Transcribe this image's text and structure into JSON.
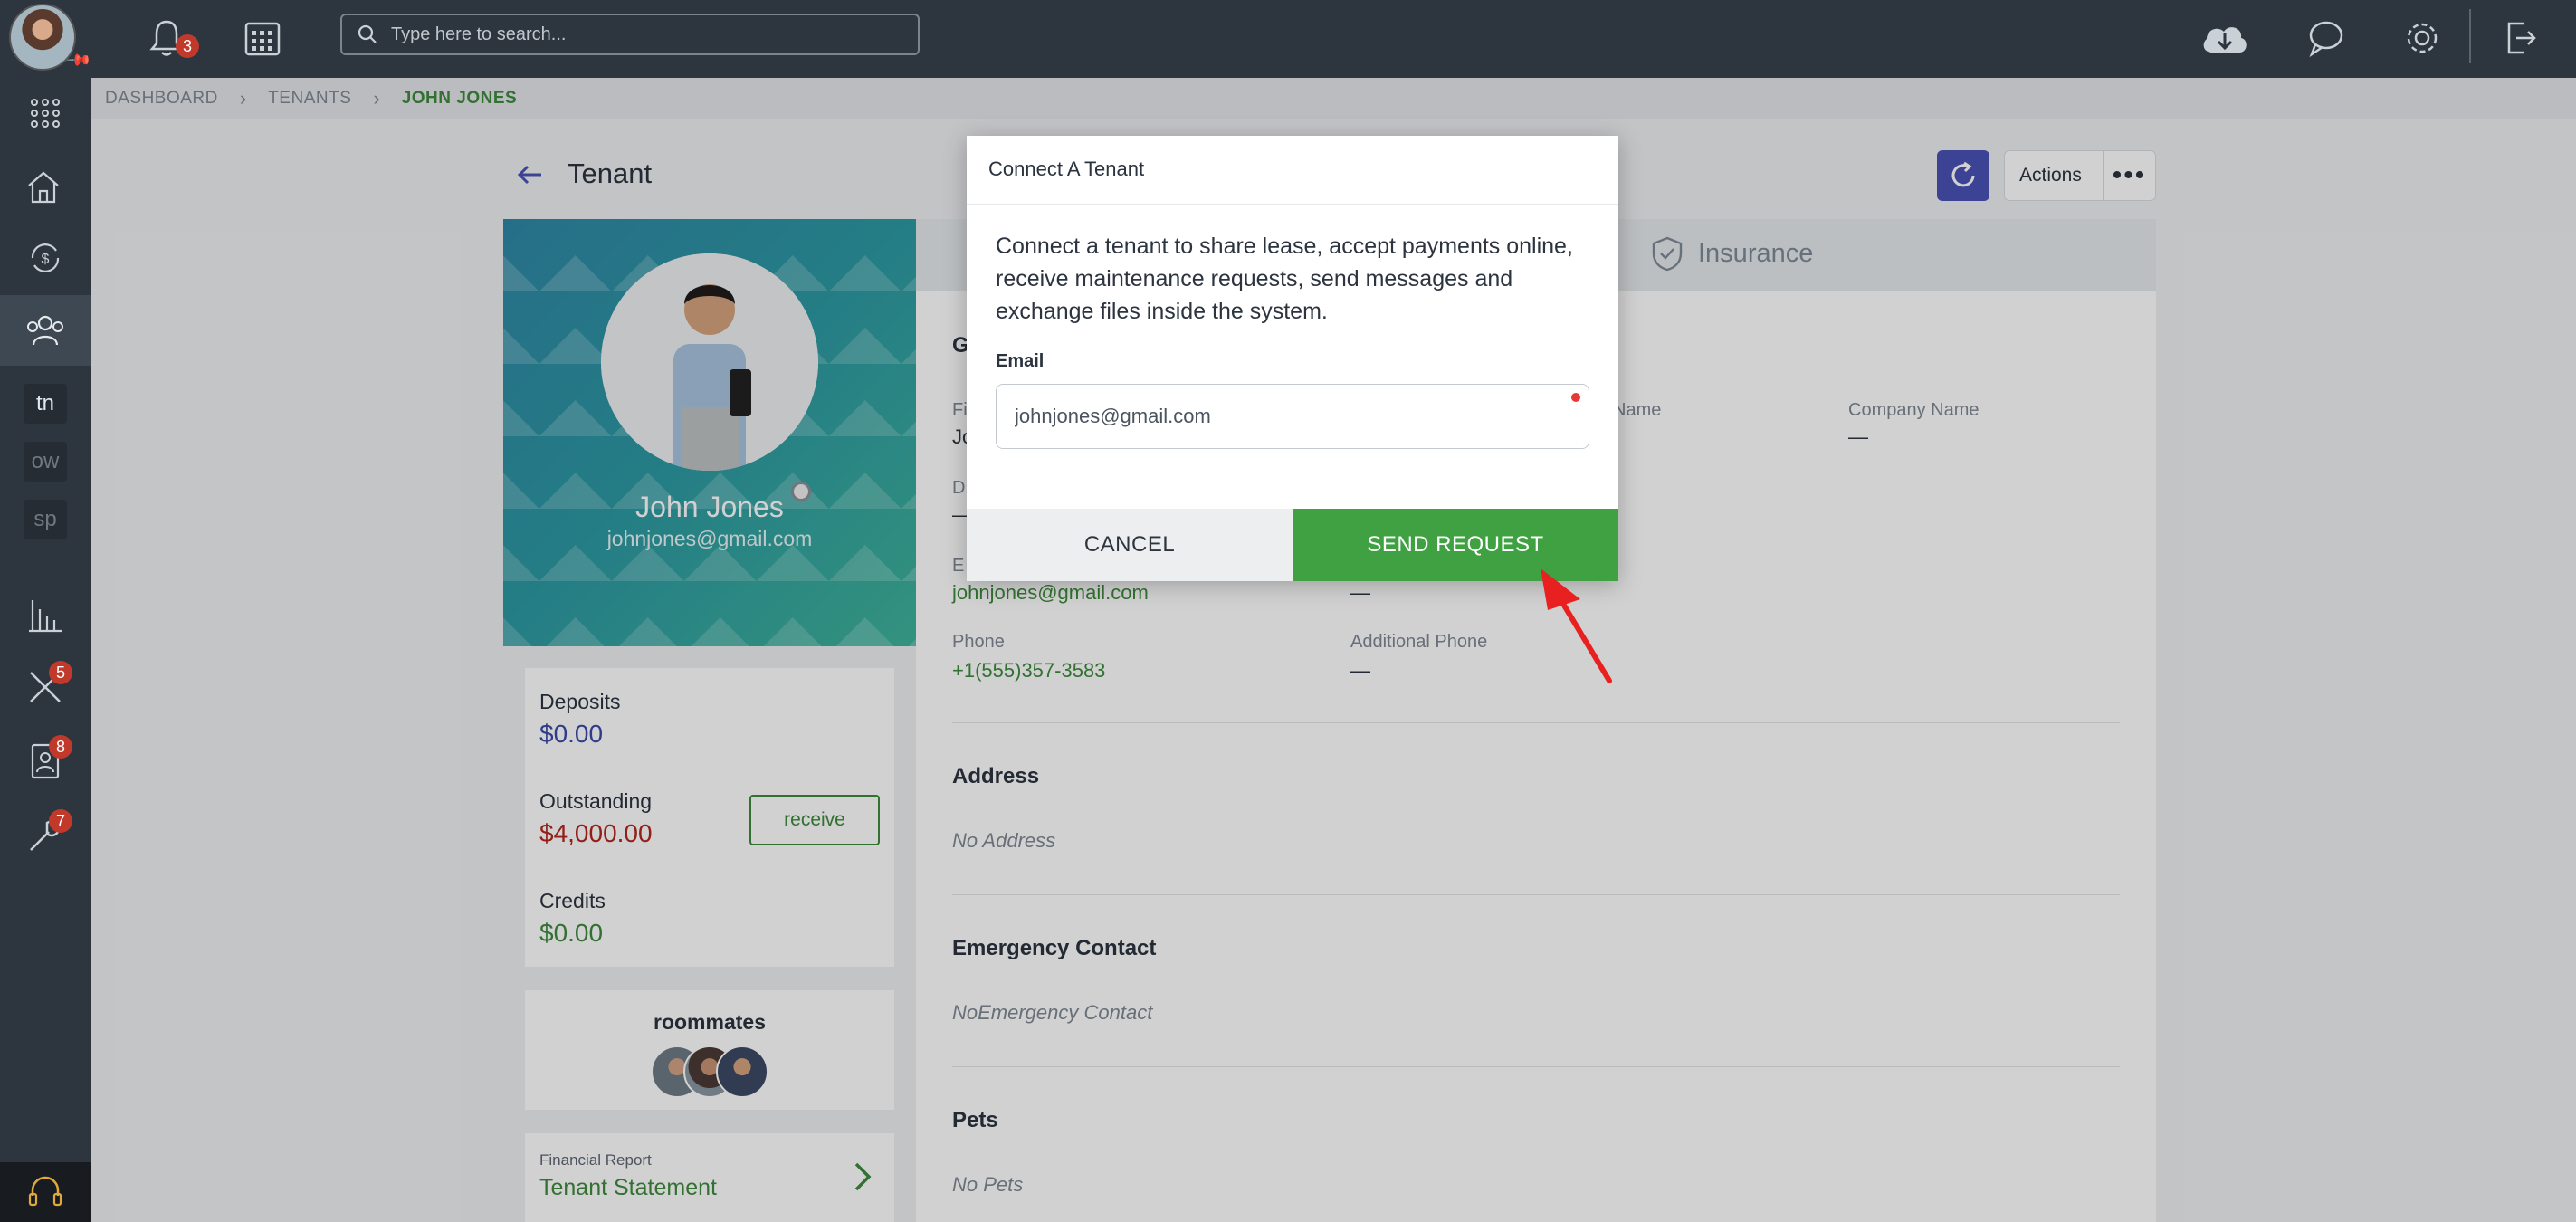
{
  "topbar": {
    "notifications_count": "3",
    "search_placeholder": "Type here to search..."
  },
  "sidebar": {
    "items": [
      {
        "name": "apps-grid-icon"
      },
      {
        "name": "properties-icon"
      },
      {
        "name": "payments-icon"
      },
      {
        "name": "people-icon",
        "active": true
      },
      {
        "label": "tn"
      },
      {
        "label": "ow"
      },
      {
        "label": "sp"
      },
      {
        "name": "reports-icon"
      },
      {
        "name": "maintenance-icon",
        "badge": "5"
      },
      {
        "name": "applications-icon",
        "badge": "8"
      },
      {
        "name": "tools-icon",
        "badge": "7"
      }
    ]
  },
  "breadcrumb": {
    "items": [
      "DASHBOARD",
      "TENANTS",
      "JOHN JONES"
    ]
  },
  "header": {
    "title": "Tenant",
    "actions_label": "Actions"
  },
  "profile": {
    "name": "John Jones",
    "email": "johnjones@gmail.com"
  },
  "balances": {
    "deposits_label": "Deposits",
    "deposits_value": "$0.00",
    "outstanding_label": "Outstanding",
    "outstanding_value": "$4,000.00",
    "credits_label": "Credits",
    "credits_value": "$0.00",
    "receive_label": "receive"
  },
  "roommates": {
    "title": "roommates"
  },
  "financial_report": {
    "small_label": "Financial Report",
    "link_label": "Tenant Statement"
  },
  "details": {
    "tab_insurance": "Insurance",
    "general_initial": "G",
    "first_name_partial_label": "Fi",
    "first_name_partial_value": "Jo",
    "dob_partial_label": "D",
    "dob_partial_value": "—",
    "email_partial_label": "E",
    "email_value": "johnjones@gmail.com",
    "last_name_partial_label": "Name",
    "company_name_label": "Company Name",
    "company_name_value": "—",
    "second_email_value": "—",
    "phone_label": "Phone",
    "phone_value": "+1(555)357-3583",
    "additional_phone_label": "Additional Phone",
    "additional_phone_value": "—",
    "address_heading": "Address",
    "address_empty": "No Address",
    "emergency_heading": "Emergency Contact",
    "emergency_empty": "NoEmergency Contact",
    "pets_heading": "Pets",
    "pets_empty": "No Pets"
  },
  "modal": {
    "title": "Connect A Tenant",
    "description": "Connect a tenant to share lease, accept payments online, receive maintenance requests, send messages and exchange files inside the system.",
    "email_label": "Email",
    "email_value": "johnjones@gmail.com",
    "cancel_label": "CANCEL",
    "send_label": "SEND REQUEST"
  },
  "colors": {
    "accent_green": "#3fa142",
    "danger_red": "#b3261e",
    "deposit_blue": "#3a4aa8",
    "topbar": "#2d353e"
  }
}
